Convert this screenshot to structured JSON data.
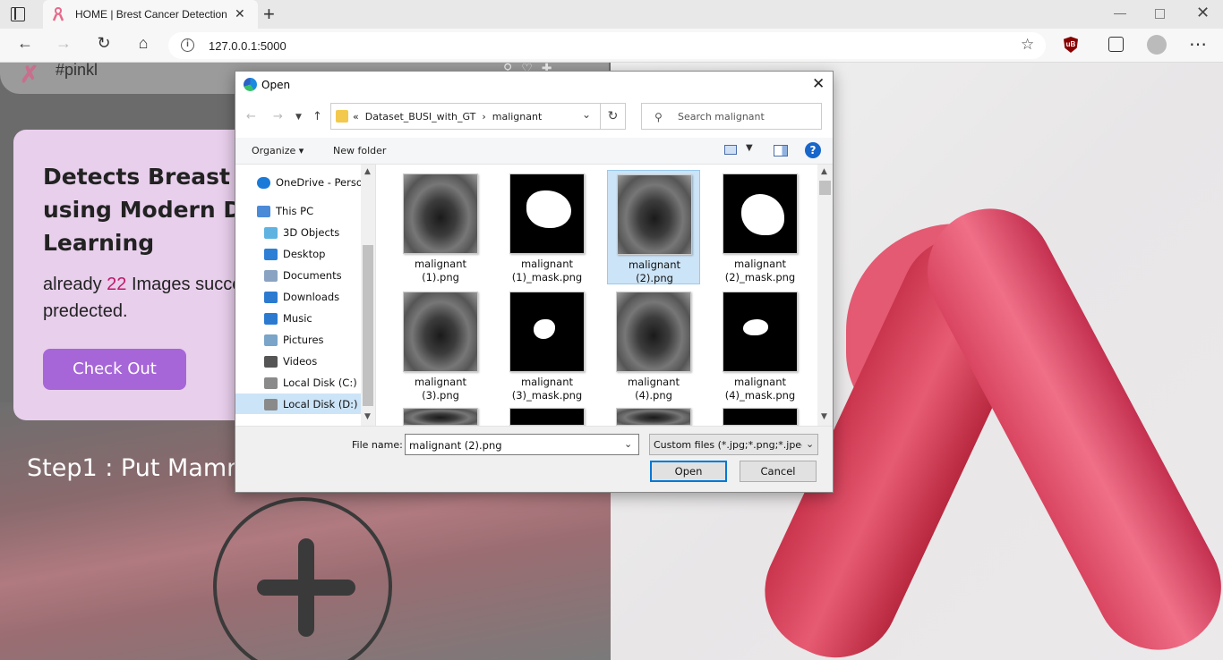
{
  "browser": {
    "tab_title": "HOME | Brest Cancer Detection",
    "url": "127.0.0.1:5000"
  },
  "site": {
    "name": "#pinkl",
    "hero": {
      "title": "Detects Breast\nusing Modern D\nLearning",
      "text_before": "already ",
      "count": "22",
      "text_after": " Images succe\npredected.",
      "button": "Check Out"
    },
    "step": "Step1 : Put Mamn"
  },
  "dialog": {
    "title": "Open",
    "path": {
      "prefix": "«",
      "parent": "Dataset_BUSI_with_GT",
      "separator": "›",
      "current": "malignant"
    },
    "search_placeholder": "Search malignant",
    "organize": "Organize ▾",
    "new_folder": "New folder",
    "help": "?",
    "nav": [
      {
        "label": "OneDrive - Person",
        "icon": "onedrive-icon"
      },
      {
        "label": "This PC",
        "icon": "pc-icon"
      },
      {
        "label": "3D Objects",
        "icon": "cube-icon"
      },
      {
        "label": "Desktop",
        "icon": "desktop-icon"
      },
      {
        "label": "Documents",
        "icon": "documents-icon"
      },
      {
        "label": "Downloads",
        "icon": "download-arrow-icon"
      },
      {
        "label": "Music",
        "icon": "music-note-icon"
      },
      {
        "label": "Pictures",
        "icon": "pictures-icon"
      },
      {
        "label": "Videos",
        "icon": "film-icon"
      },
      {
        "label": "Local Disk (C:)",
        "icon": "drive-icon"
      },
      {
        "label": "Local Disk (D:)",
        "icon": "drive-icon"
      }
    ],
    "files": [
      {
        "label": "malignant\n(1).png",
        "kind": "ultrasound"
      },
      {
        "label": "malignant\n(1)_mask.png",
        "kind": "mask"
      },
      {
        "label": "malignant\n(2).png",
        "kind": "ultrasound",
        "selected": true
      },
      {
        "label": "malignant\n(2)_mask.png",
        "kind": "mask"
      },
      {
        "label": "malignant\n(3).png",
        "kind": "ultrasound"
      },
      {
        "label": "malignant\n(3)_mask.png",
        "kind": "mask"
      },
      {
        "label": "malignant\n(4).png",
        "kind": "ultrasound"
      },
      {
        "label": "malignant\n(4)_mask.png",
        "kind": "mask"
      }
    ],
    "file_name_label": "File name:",
    "file_name_value": "malignant (2).png",
    "filter": "Custom files (*.jpg;*.png;*.jpeg",
    "open_button": "Open",
    "cancel_button": "Cancel"
  },
  "colors": {
    "accent": "#0078d7",
    "selection": "#cce4f7",
    "hero_card": "#e8cfec",
    "hero_button": "#a766d8",
    "count_highlight": "#c0186a"
  }
}
